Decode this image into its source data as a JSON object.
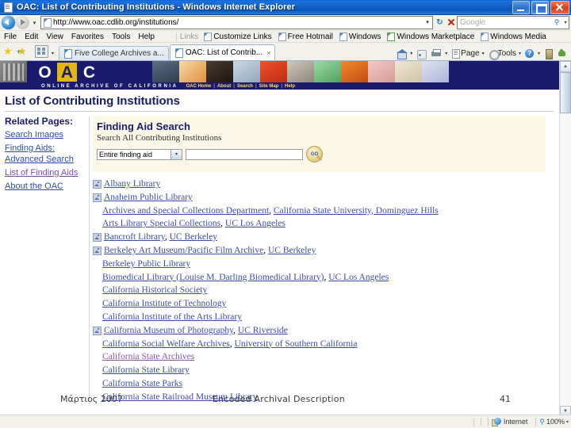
{
  "window": {
    "title": "OAC: List of Contributing Institutions - Windows Internet Explorer",
    "icon": "page-icon",
    "minimize_label": "Minimize",
    "maximize_label": "Restore",
    "close_label": "Close"
  },
  "address_bar": {
    "back_label": "Back",
    "forward_label": "Forward",
    "history_caret": "▾",
    "url": "http://www.oac.cdlib.org/institutions/",
    "url_caret": "▾",
    "refresh_label": "↻",
    "stop_label": "Stop",
    "search_placeholder": "Google",
    "search_value": "",
    "search_caret": "▾",
    "search_icon": "magnifier-icon"
  },
  "menubar": {
    "items": [
      "File",
      "Edit",
      "View",
      "Favorites",
      "Tools",
      "Help"
    ],
    "links_label": "Links",
    "links": [
      "Customize Links",
      "Free Hotmail",
      "Windows",
      "Windows Marketplace",
      "Windows Media"
    ]
  },
  "tabbar": {
    "favorites_star": "favorites-star-icon",
    "add_favorite": "add-to-favorites-icon",
    "quick_tabs": "quick-tabs-icon",
    "tab_list_caret": "▾",
    "tabs": [
      {
        "label": "Five College Archives a...",
        "active": false,
        "close": ""
      },
      {
        "label": "OAC: List of Contrib...",
        "active": true,
        "close": "×"
      }
    ],
    "tools": [
      {
        "name": "home",
        "label": "",
        "caret": "▾"
      },
      {
        "name": "feeds",
        "label": "",
        "caret": ""
      },
      {
        "name": "print",
        "label": "",
        "caret": "▾"
      },
      {
        "name": "page",
        "label": "Page",
        "caret": "▾"
      },
      {
        "name": "tools",
        "label": "Tools",
        "caret": "▾"
      },
      {
        "name": "help",
        "label": "",
        "caret": "▾"
      },
      {
        "name": "research",
        "label": "",
        "caret": ""
      },
      {
        "name": "messenger",
        "label": "",
        "caret": ""
      }
    ]
  },
  "banner": {
    "logo_letters": [
      "O",
      "A",
      "C"
    ],
    "wordmark": "ONLINE ARCHIVE OF CALIFORNIA",
    "nav": [
      "OAC Home",
      "About",
      "Search",
      "Site Map",
      "Help"
    ],
    "nav_separator": "|"
  },
  "page": {
    "title": "List of Contributing Institutions"
  },
  "sidebar": {
    "title": "Related Pages:",
    "links": [
      {
        "label": "Search Images",
        "visited": false
      },
      {
        "label": "Finding Aids: Advanced Search",
        "visited": false
      },
      {
        "label": "List of Finding Aids",
        "visited": true
      },
      {
        "label": "About the OAC",
        "visited": false
      }
    ]
  },
  "search_panel": {
    "title": "Finding Aid Search",
    "subtitle": "Search All Contributing Institutions",
    "scope_selected": "Entire finding aid",
    "scope_options": [
      "Entire finding aid"
    ],
    "scope_caret": "▾",
    "query_value": "",
    "query_placeholder": "",
    "go_label": "GO",
    "go_icon": "magnifier-go-icon"
  },
  "institutions": [
    {
      "icon": true,
      "parts": [
        {
          "t": "Albany Library",
          "link": true,
          "visited": false
        }
      ]
    },
    {
      "icon": true,
      "parts": [
        {
          "t": "Anaheim Public Library",
          "link": true,
          "visited": false
        }
      ]
    },
    {
      "icon": false,
      "parts": [
        {
          "t": "Archives and Special Collections Department",
          "link": true,
          "visited": false
        },
        {
          "t": ", ",
          "link": false
        },
        {
          "t": "California State University, Dominguez Hills",
          "link": true,
          "visited": false
        }
      ]
    },
    {
      "icon": false,
      "parts": [
        {
          "t": "Arts Library Special Collections",
          "link": true,
          "visited": false
        },
        {
          "t": ", ",
          "link": false
        },
        {
          "t": "UC Los Angeles",
          "link": true,
          "visited": false
        }
      ]
    },
    {
      "icon": true,
      "parts": [
        {
          "t": "Bancroft Library",
          "link": true,
          "visited": false
        },
        {
          "t": ", ",
          "link": false
        },
        {
          "t": "UC Berkeley",
          "link": true,
          "visited": false
        }
      ]
    },
    {
      "icon": true,
      "parts": [
        {
          "t": "Berkeley Art Museum/Pacific Film Archive",
          "link": true,
          "visited": false
        },
        {
          "t": ", ",
          "link": false
        },
        {
          "t": "UC Berkeley",
          "link": true,
          "visited": false
        }
      ]
    },
    {
      "icon": false,
      "parts": [
        {
          "t": "Berkeley Public Library",
          "link": true,
          "visited": false
        }
      ]
    },
    {
      "icon": false,
      "parts": [
        {
          "t": "Biomedical Library (Louise M. Darling Biomedical Library)",
          "link": true,
          "visited": false
        },
        {
          "t": ", ",
          "link": false
        },
        {
          "t": "UC Los Angeles",
          "link": true,
          "visited": false
        }
      ]
    },
    {
      "icon": false,
      "parts": [
        {
          "t": "California Historical Society",
          "link": true,
          "visited": false
        }
      ]
    },
    {
      "icon": false,
      "parts": [
        {
          "t": "California Institute of Technology",
          "link": true,
          "visited": false
        }
      ]
    },
    {
      "icon": false,
      "parts": [
        {
          "t": "California Institute of the Arts Library",
          "link": true,
          "visited": false
        }
      ]
    },
    {
      "icon": true,
      "parts": [
        {
          "t": "California Museum of Photography",
          "link": true,
          "visited": false
        },
        {
          "t": ", ",
          "link": false
        },
        {
          "t": "UC Riverside",
          "link": true,
          "visited": false
        }
      ]
    },
    {
      "icon": false,
      "parts": [
        {
          "t": "California Social Welfare Archives",
          "link": true,
          "visited": false
        },
        {
          "t": ", ",
          "link": false
        },
        {
          "t": "University of Southern California",
          "link": true,
          "visited": false
        }
      ]
    },
    {
      "icon": false,
      "parts": [
        {
          "t": "California State Archives",
          "link": true,
          "visited": true
        }
      ]
    },
    {
      "icon": false,
      "parts": [
        {
          "t": "California State Library",
          "link": true,
          "visited": false
        }
      ]
    },
    {
      "icon": false,
      "parts": [
        {
          "t": "California State Parks",
          "link": true,
          "visited": false
        }
      ]
    },
    {
      "icon": false,
      "parts": [
        {
          "t": "California State Railroad Museum Library",
          "link": true,
          "visited": false
        }
      ]
    }
  ],
  "slide_footer": {
    "left": "Μάρτιος 2007",
    "center": "Encoded Archival Description",
    "right": "41"
  },
  "statusbar": {
    "message": "",
    "zone": "Internet",
    "zone_icon": "internet-zone-icon",
    "zoom": "100%",
    "zoom_icon": "zoom-icon",
    "zoom_caret": "▾"
  },
  "scrollbar": {
    "up_arrow": "▲",
    "down_arrow": "▼"
  },
  "colors": {
    "title_blue": "#1b1b6e",
    "accent_gold": "#e3b80c",
    "link": "#3b4da8",
    "visited": "#8a5aa8",
    "panel_cream": "#fbf8e8"
  }
}
